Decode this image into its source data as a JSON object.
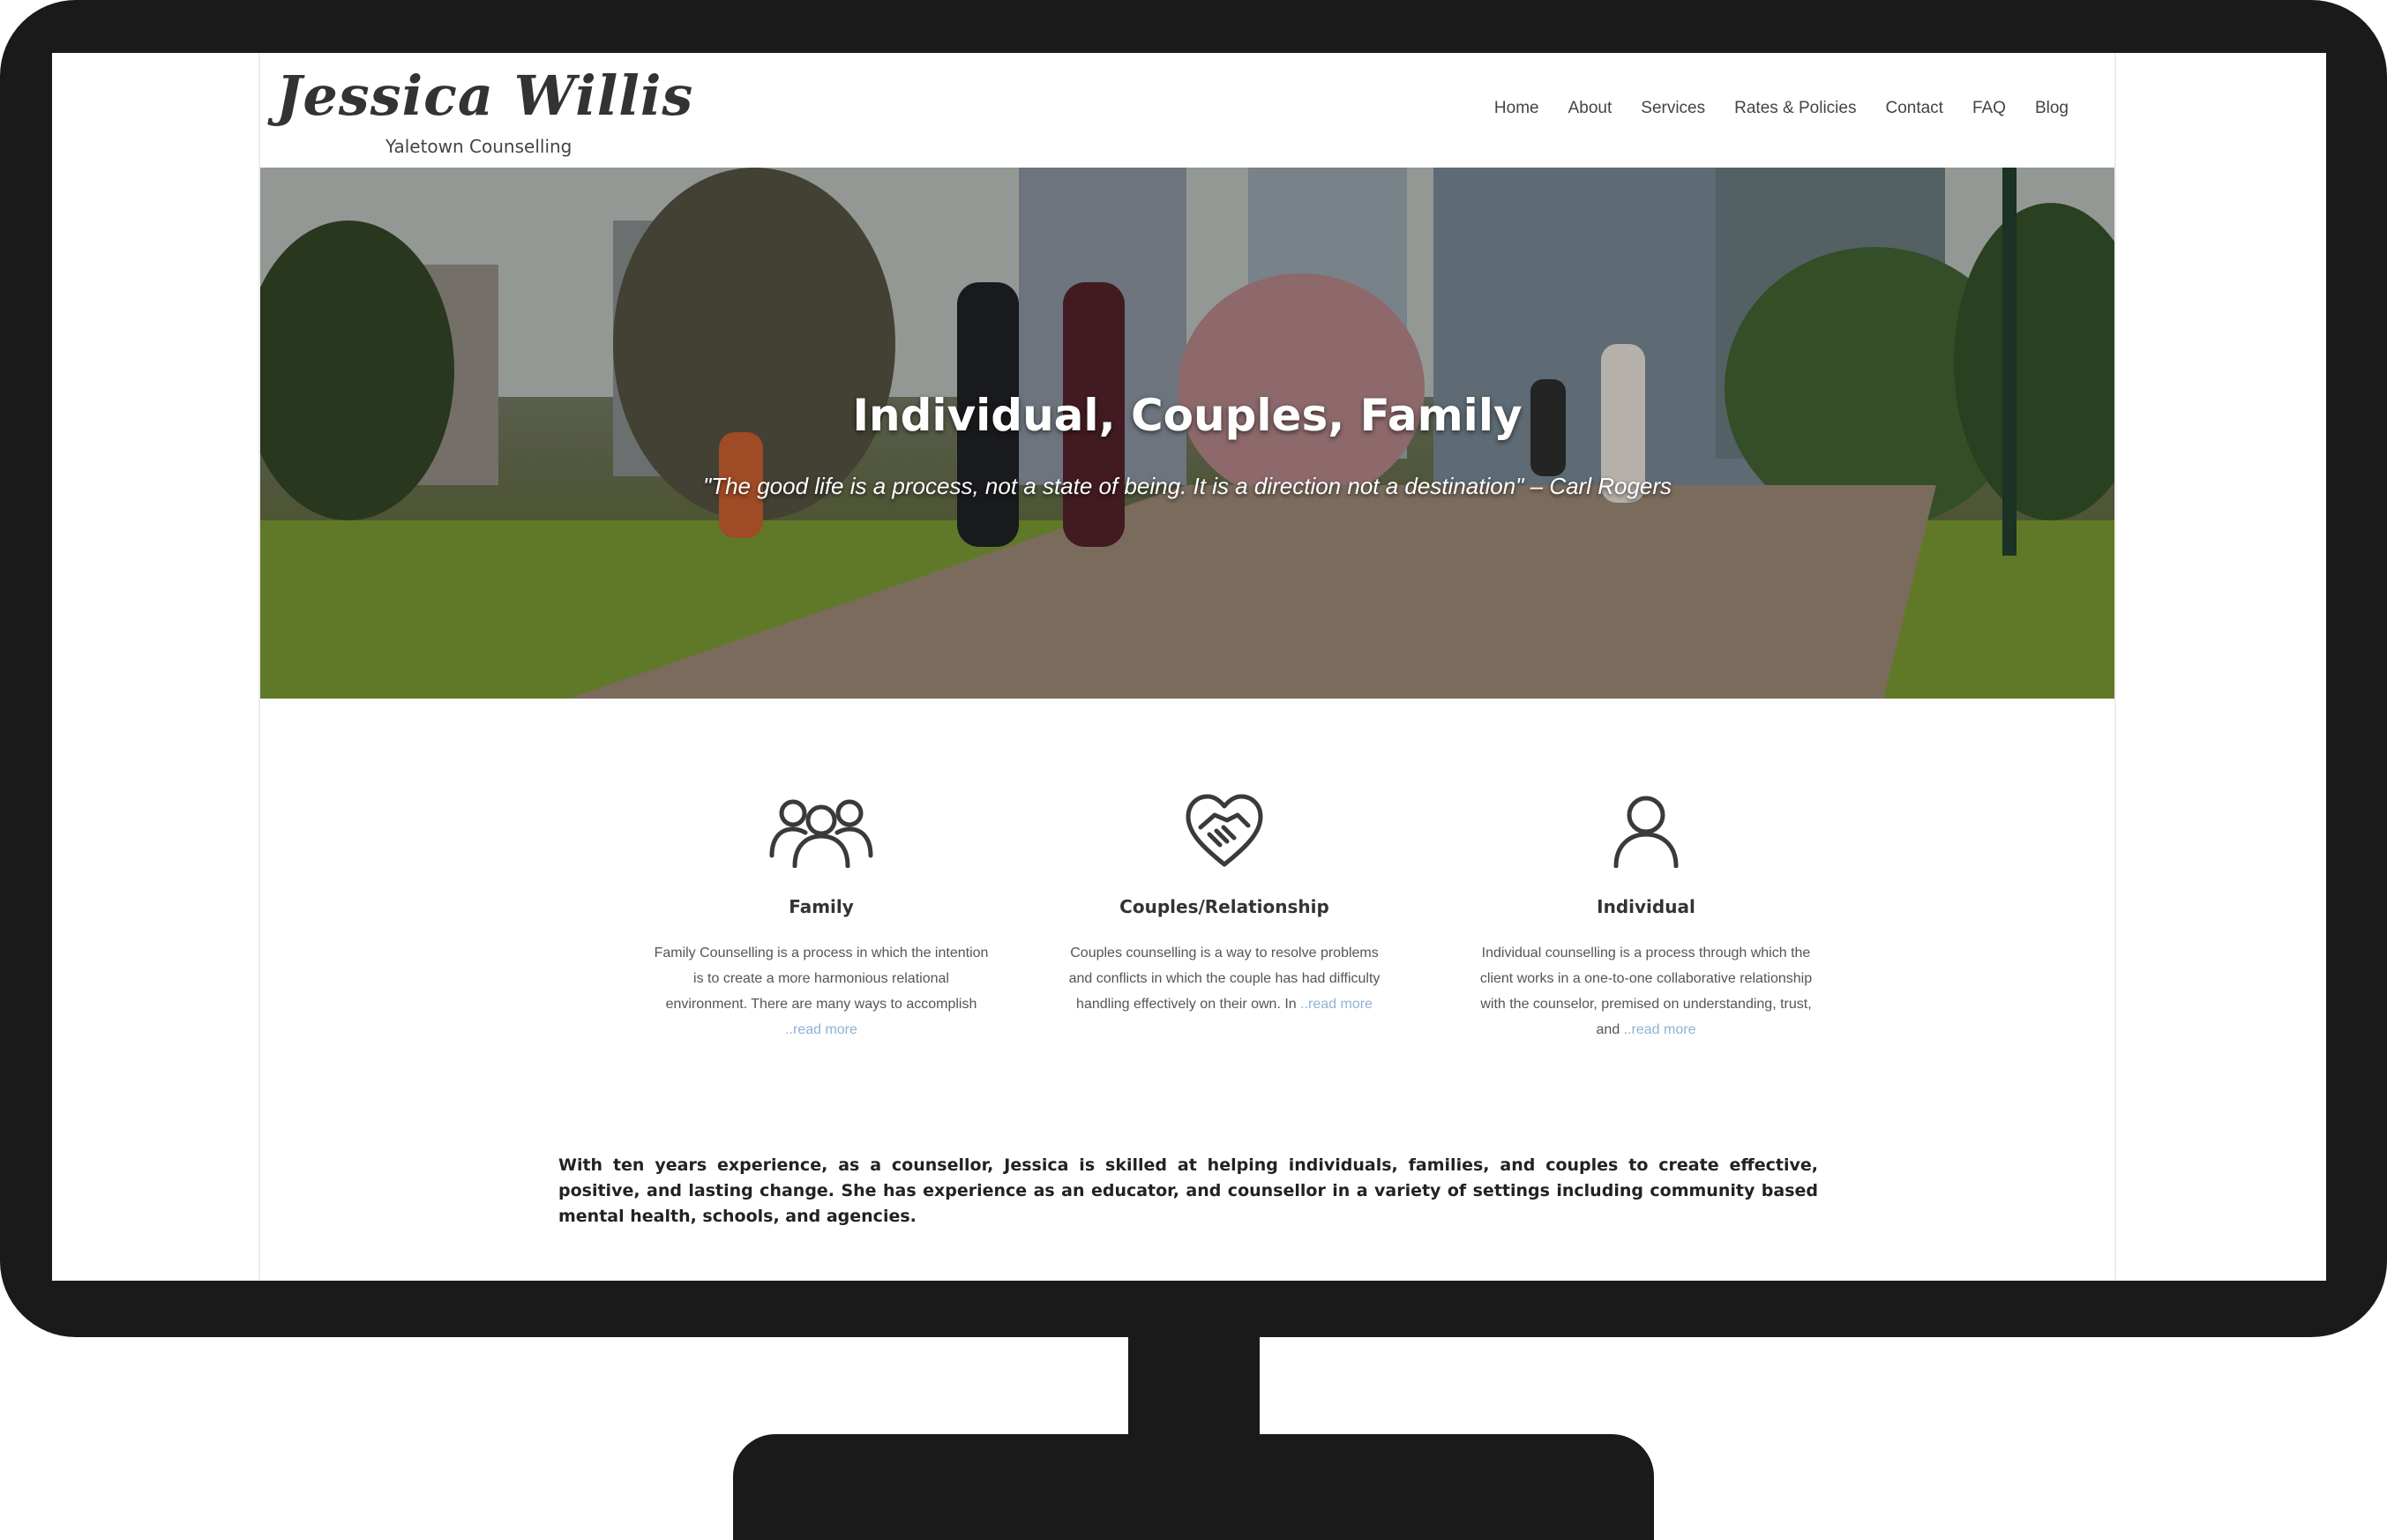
{
  "site": {
    "logo_name": "Jessica Willis",
    "logo_tagline": "Yaletown Counselling"
  },
  "nav": {
    "items": [
      "Home",
      "About",
      "Services",
      "Rates & Policies",
      "Contact",
      "FAQ",
      "Blog"
    ]
  },
  "hero": {
    "title": "Individual, Couples, Family",
    "quote": "\"The good life is a process, not a state of being. It is a direction not a destination\" – Carl Rogers"
  },
  "services": [
    {
      "icon": "family-icon",
      "title": "Family",
      "text": "Family Counselling is a process in which the intention is to create a more harmonious relational environment.  There are many ways to accomplish ",
      "read_more": "..read more"
    },
    {
      "icon": "handshake-heart-icon",
      "title": "Couples/Relationship",
      "text": "Couples counselling is a way to resolve problems and conflicts in which the couple has had difficulty handling effectively on their own.  In ",
      "read_more": "..read more"
    },
    {
      "icon": "person-icon",
      "title": "Individual",
      "text": "Individual counselling is a process through which the client works in a one-to-one collaborative relationship with the counselor, premised on understanding, trust, and ",
      "read_more": "..read more"
    }
  ],
  "about": {
    "text": "With ten years experience, as a counsellor, Jessica is skilled at helping individuals, families, and couples to create effective, positive, and lasting change. She has experience as an educator, and counsellor in a variety of settings including community based mental health, schools, and agencies."
  },
  "colors": {
    "bezel": "#1a1a1a",
    "link": "#8fb1d6",
    "text": "#333333"
  }
}
